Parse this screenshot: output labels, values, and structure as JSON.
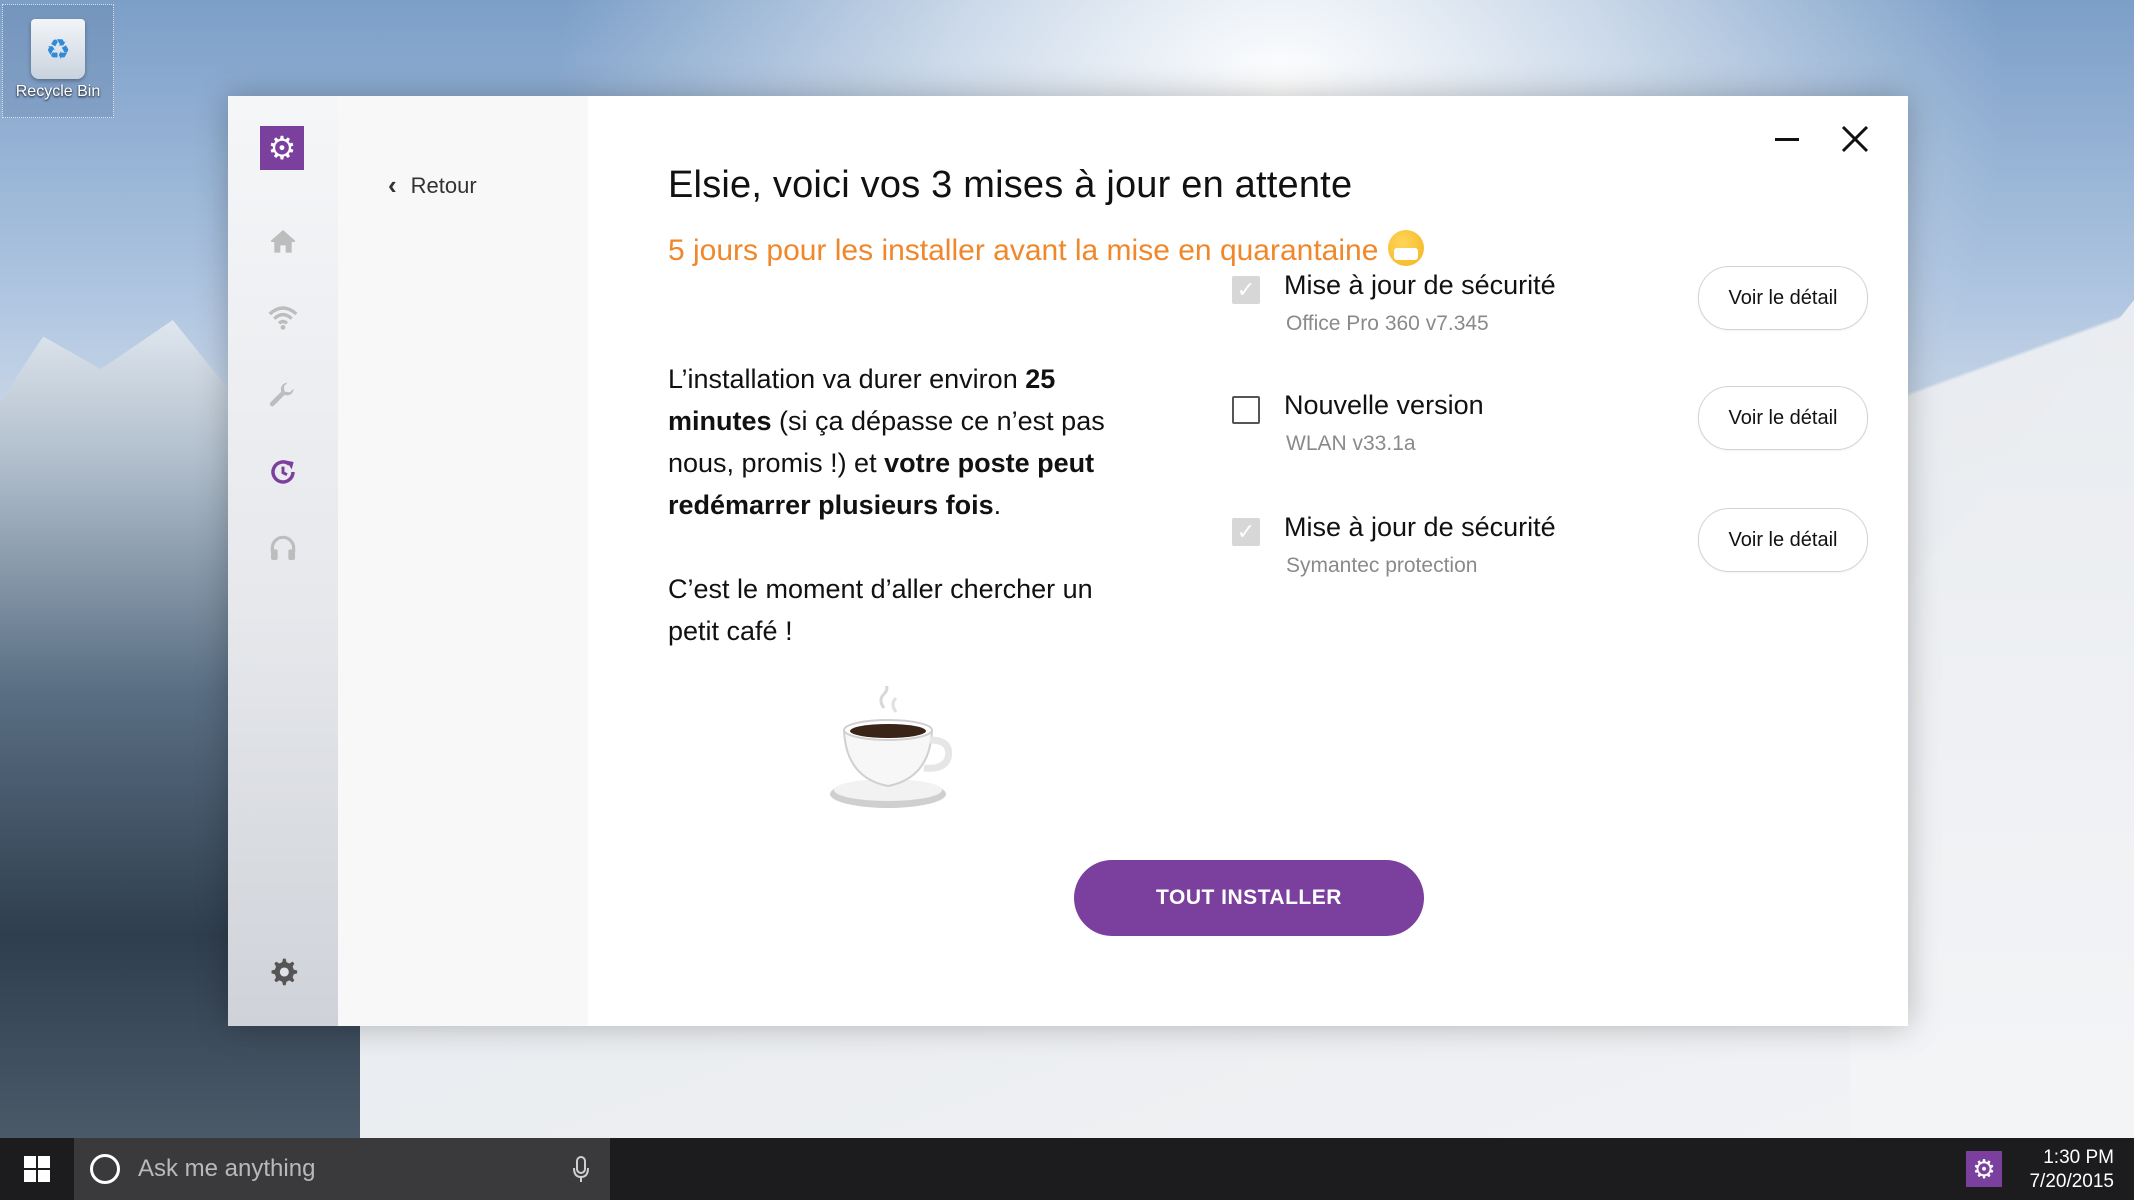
{
  "desktop": {
    "recycle_bin_label": "Recycle Bin"
  },
  "app": {
    "accent": "#7b3f9e",
    "subtitle_color": "#f0872a",
    "back_label": "Retour",
    "nav_icons": [
      "home-icon",
      "wifi-icon",
      "wrench-icon",
      "update-icon",
      "headset-icon",
      "gear-icon"
    ],
    "title": "Elsie, voici vos 3 mises à jour en attente",
    "subtitle": "5 jours pour les installer avant la mise en quarantaine",
    "description": {
      "part1": "L’installation va durer environ ",
      "bold1": "25 minutes",
      "part2": " (si ça dépasse ce n’est pas nous, promis !) et ",
      "bold2": "votre poste peut redémarrer plusieurs fois",
      "part3": "."
    },
    "coffee_text": "C’est le moment d’aller chercher un petit café !",
    "updates": [
      {
        "name": "Mise à jour de sécurité",
        "version": "Office Pro 360 v7.345",
        "checked": true,
        "button": "Voir le détail"
      },
      {
        "name": "Nouvelle version",
        "version": "WLAN v33.1a",
        "checked": false,
        "button": "Voir le détail"
      },
      {
        "name": "Mise à jour de sécurité",
        "version": "Symantec protection",
        "checked": true,
        "button": "Voir le détail"
      }
    ],
    "install_button": "TOUT INSTALLER"
  },
  "taskbar": {
    "search_placeholder": "Ask me anything",
    "time": "1:30 PM",
    "date": "7/20/2015"
  }
}
